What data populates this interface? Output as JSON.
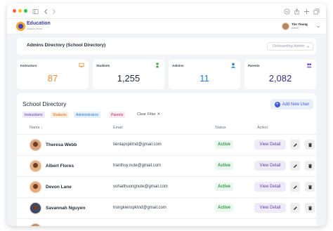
{
  "app": {
    "brand": "Education",
    "brand_sub": "Academic Portal"
  },
  "user": {
    "name": "Tim Young",
    "role": "Admin"
  },
  "header": {
    "title": "Admins Directory (School Directory)",
    "dropdown": "Onboarding Admin"
  },
  "stats": [
    {
      "label": "Instructors",
      "value": "87",
      "icon": "presentation-icon",
      "color": "#f08c2e"
    },
    {
      "label": "Students",
      "value": "1,255",
      "icon": "hourglass-icon",
      "color": "#2f9e44"
    },
    {
      "label": "Admins",
      "value": "11",
      "icon": "person-icon",
      "color": "#1c7ed6"
    },
    {
      "label": "Parents",
      "value": "2,082",
      "icon": "group-icon",
      "color": "#7048e8"
    }
  ],
  "directory": {
    "title": "School Directory",
    "add_button": "Add New User",
    "filters": [
      {
        "label": "Instructions",
        "bg": "#efeaf8",
        "fg": "#5b3fa3"
      },
      {
        "label": "Students",
        "bg": "#fdf1e3",
        "fg": "#e8590c"
      },
      {
        "label": "Administrators",
        "bg": "#e7f0fd",
        "fg": "#1c7ed6"
      },
      {
        "label": "Parents",
        "bg": "#fbe9f2",
        "fg": "#c2255c"
      }
    ],
    "clear_filter": "Clear Filter",
    "columns": {
      "name": "Name",
      "email": "Email",
      "status": "Status",
      "action": "Action"
    },
    "view_label": "View Detail",
    "rows": [
      {
        "name": "Theresa Webb",
        "email": "tienlapspktnd@gmail.com",
        "status": "Active"
      },
      {
        "name": "Albert Flores",
        "email": "tranthuy.nute@gmail.com",
        "status": "Active"
      },
      {
        "name": "Devon Lane",
        "email": "vuhaithuongnute@gmail.com",
        "status": "Active"
      },
      {
        "name": "Savannah Nguyen",
        "email": "trungkienspktnd@gmail.com",
        "status": "Active"
      }
    ]
  }
}
